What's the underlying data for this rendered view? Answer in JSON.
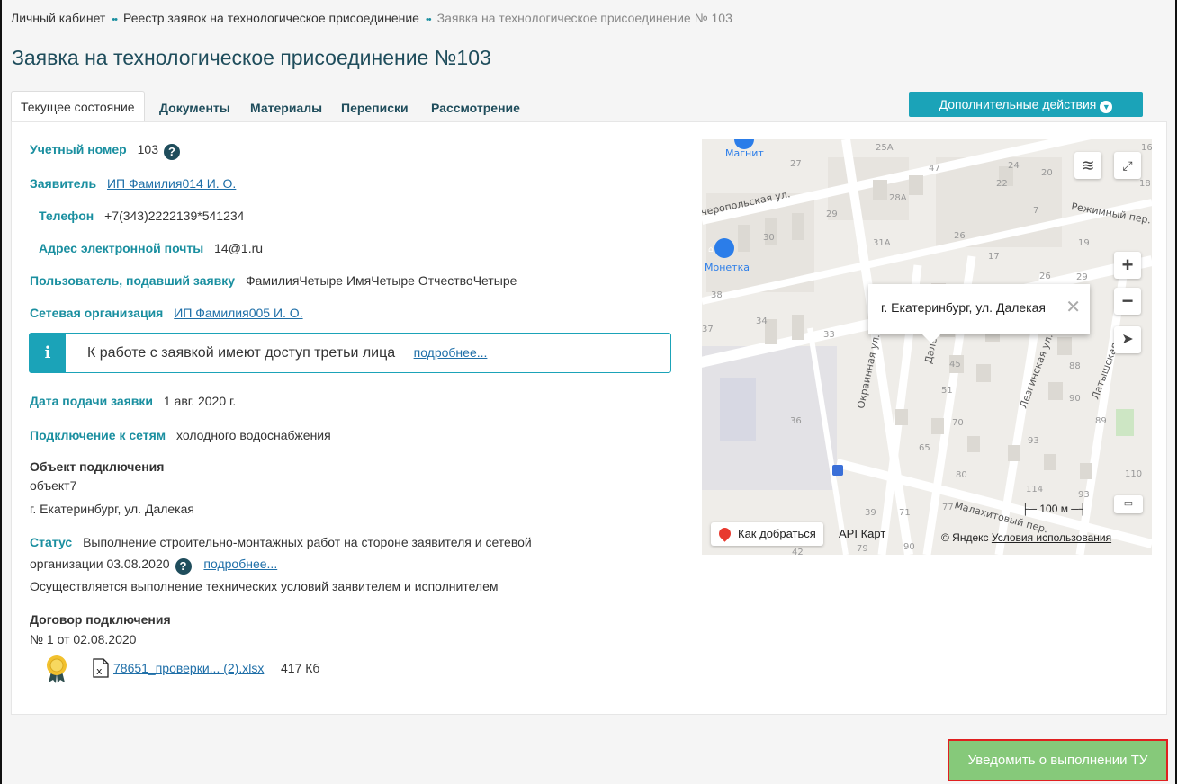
{
  "breadcrumb": {
    "items": [
      "Личный кабинет",
      "Реестр заявок на технологическое присоединение"
    ],
    "separator": "••",
    "current": "Заявка на технологическое присоединение № 103"
  },
  "page_title": "Заявка на технологическое присоединение №103",
  "tabs": [
    "Текущее состояние",
    "Документы",
    "Материалы",
    "Переписки",
    "Рассмотрение"
  ],
  "more_actions_label": "Дополнительные действия",
  "details": {
    "account_label": "Учетный номер",
    "account_value": "103",
    "applicant_label": "Заявитель",
    "applicant_value": "ИП Фамилия014 И. О.",
    "phone_label": "Телефон",
    "phone_value": "+7(343)2222139*541234",
    "email_label": "Адрес электронной почты",
    "email_value": "14@1.ru",
    "submitter_label": "Пользователь, подавший заявку",
    "submitter_value": "ФамилияЧетыре ИмяЧетыре ОтчествоЧетыре",
    "network_org_label": "Сетевая организация",
    "network_org_value": "ИП Фамилия005 И. О.",
    "info_text": "К работе с заявкой имеют доступ третьи лица",
    "info_link": "подробнее...",
    "date_label": "Дата подачи заявки",
    "date_value": "1 авг. 2020 г.",
    "connection_label": "Подключение к сетям",
    "connection_value": "холодного водоснабжения",
    "object_label": "Объект подключения",
    "object_name": "объект7",
    "object_address": "г. Екатеринбург, ул. Далекая",
    "status_label": "Статус",
    "status_value_line1": "Выполнение строительно-монтажных работ на стороне заявителя и сетевой",
    "status_value_line2": "организации 03.08.2020",
    "status_link": "подробнее...",
    "status_note": "Осуществляется выполнение технических условий заявителем и исполнителем",
    "contract_label": "Договор подключения",
    "contract_value": "№ 1 от 02.08.2020",
    "file_name": "78651_проверки... (2).xlsx",
    "file_size": "417 Кб"
  },
  "map": {
    "balloon_text": "г. Екатеринбург, ул. Далекая",
    "route_label": "Как добраться",
    "api_label": "API Карт",
    "copyright": "© Яндекс",
    "terms_label": "Условия использования",
    "scale_label": "100 м",
    "streets": [
      "Черепопольская ул.",
      "Режимный пер.",
      "Окраинная ул.",
      "Далекая ул.",
      "Лезгинская ул.",
      "Латышская ул.",
      "Малахитовый пер."
    ],
    "pois": [
      "Магнит",
      "Монетка"
    ],
    "house_numbers": [
      "27",
      "25А",
      "47",
      "24",
      "20",
      "22",
      "28А",
      "29",
      "30",
      "31А",
      "26",
      "17",
      "7",
      "19",
      "26",
      "29",
      "38",
      "34",
      "33",
      "37",
      "45",
      "51",
      "88",
      "90",
      "36",
      "70",
      "93",
      "89",
      "65",
      "80",
      "114",
      "110",
      "93",
      "39",
      "71",
      "77",
      "90",
      "79",
      "42",
      "18",
      "16"
    ]
  },
  "notify_button_label": "Уведомить о выполнении ТУ"
}
